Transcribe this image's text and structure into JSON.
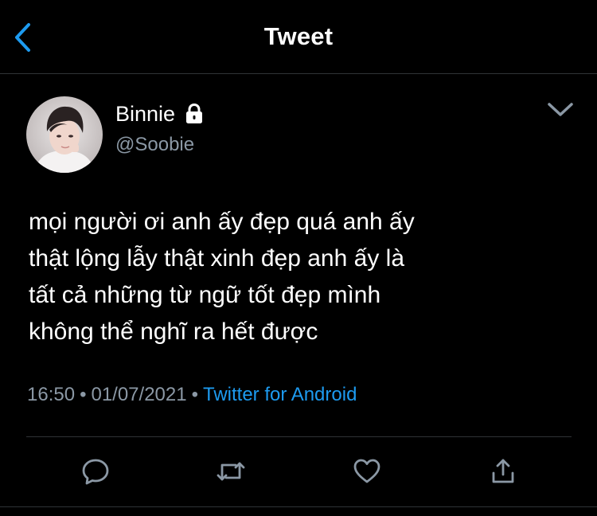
{
  "header": {
    "title": "Tweet",
    "back_icon": "chevron-left-icon"
  },
  "author": {
    "display_name": "Binnie",
    "handle": "@Soobie",
    "protected_icon": "lock-icon"
  },
  "tweet": {
    "lines": [
      "mọi người ơi anh ấy đẹp quá anh ấy",
      "thật lộng lẫy thật xinh đẹp anh ấy là",
      "tất cả những từ ngữ tốt đẹp mình",
      "không thể nghĩ ra hết được"
    ],
    "time": "16:50",
    "date": "01/07/2021",
    "separator": "•",
    "source": "Twitter for Android"
  },
  "actions": {
    "reply_icon": "reply-icon",
    "retweet_icon": "retweet-icon",
    "like_icon": "heart-icon",
    "share_icon": "share-icon"
  },
  "colors": {
    "background": "#000000",
    "text": "#ffffff",
    "secondary": "#8b98a5",
    "accent": "#1d9bf0",
    "divider": "#2f3336"
  }
}
